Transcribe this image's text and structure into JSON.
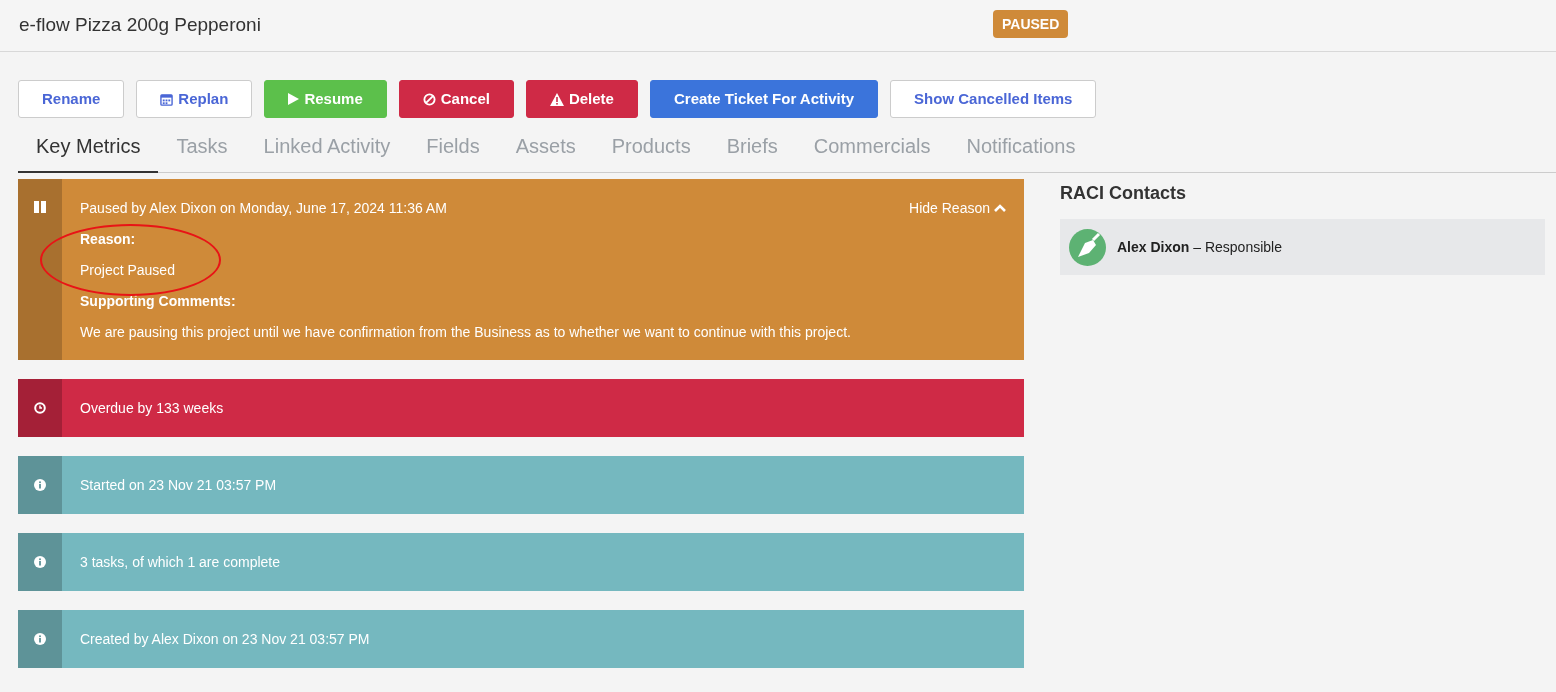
{
  "header": {
    "title": "e-flow Pizza 200g Pepperoni",
    "status_badge": "PAUSED"
  },
  "buttons": [
    {
      "label": "Rename",
      "kind": "rename"
    },
    {
      "label": "Replan",
      "kind": "replan"
    },
    {
      "label": "Resume",
      "kind": "resume"
    },
    {
      "label": "Cancel",
      "kind": "cancel"
    },
    {
      "label": "Delete",
      "kind": "delete"
    },
    {
      "label": "Create Ticket For Activity",
      "kind": "ticket"
    },
    {
      "label": "Show Cancelled Items",
      "kind": "show"
    }
  ],
  "tabs": [
    {
      "label": "Key Metrics",
      "selected": true
    },
    {
      "label": "Tasks",
      "selected": false
    },
    {
      "label": "Linked Activity",
      "selected": false
    },
    {
      "label": "Fields",
      "selected": false
    },
    {
      "label": "Assets",
      "selected": false
    },
    {
      "label": "Products",
      "selected": false
    },
    {
      "label": "Briefs",
      "selected": false
    },
    {
      "label": "Commercials",
      "selected": false
    },
    {
      "label": "Notifications",
      "selected": false
    }
  ],
  "pause_notice": {
    "text": "Paused by Alex Dixon on Monday, June 17, 2024 11:36 AM",
    "toggle": "Hide Reason",
    "expanded": true,
    "reason_label": "Reason:",
    "reason": "Project Paused",
    "comments_label": "Supporting Comments:",
    "comments": "We are pausing this project until we have confirmation from the Business as to whether we want to continue with this project."
  },
  "alerts": [
    {
      "kind": "danger",
      "text": "Overdue by 133 weeks"
    },
    {
      "kind": "info",
      "text": "Started on 23 Nov 21 03:57 PM"
    },
    {
      "kind": "info",
      "text": "3 tasks, of which 1 are complete"
    },
    {
      "kind": "info",
      "text": "Created by Alex Dixon on 23 Nov 21 03:57 PM"
    }
  ],
  "raci": {
    "title": "RACI Contacts",
    "contacts": [
      {
        "name": "Alex Dixon",
        "separator": "–",
        "role": "Responsible"
      }
    ]
  },
  "annotations": [
    {
      "kind": "ellipse"
    }
  ]
}
